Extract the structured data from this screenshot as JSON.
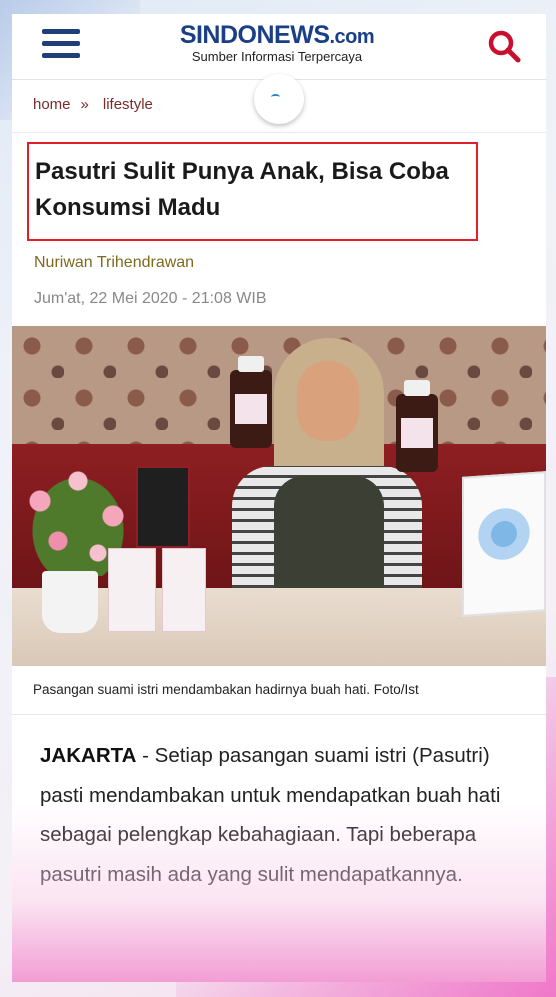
{
  "header": {
    "logo_main": "SINDONEWS",
    "logo_suffix": ".com",
    "logo_tagline": "Sumber Informasi Terpercaya",
    "menu_icon": "hamburger-menu-icon",
    "search_icon": "search-icon",
    "brand_color": "#1a3f86",
    "accent_color": "#c8102e"
  },
  "breadcrumb": {
    "home": "home",
    "separator": "»",
    "category": "lifestyle"
  },
  "article": {
    "title": "Pasutri Sulit Punya Anak, Bisa Coba Konsumsi Madu",
    "author": "Nuriwan Trihendrawan",
    "date": "Jum'at, 22 Mei 2020 - 21:08 WIB",
    "image_caption": "Pasangan suami istri mendambakan hadirnya buah hati. Foto/Ist",
    "dateline": "JAKARTA",
    "lead": " - Setiap pasangan suami istri (Pasutri) pasti mendambakan untuk mendapatkan buah hati sebagai pelengkap kebahagiaan. Tapi beberapa pasutri masih ada yang sulit mendapatkannya.",
    "title_highlight_color": "#e01f26"
  }
}
